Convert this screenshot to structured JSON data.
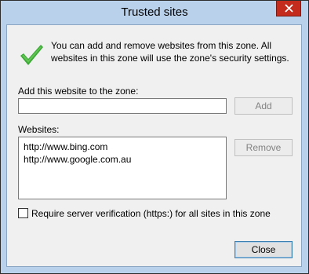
{
  "window": {
    "title": "Trusted sites"
  },
  "info_text": "You can add and remove websites from this zone. All websites in this zone will use the zone's security settings.",
  "add": {
    "label": "Add this website to the zone:",
    "value": "",
    "button": "Add"
  },
  "websites": {
    "label": "Websites:",
    "items": [
      "http://www.bing.com",
      "http://www.google.com.au"
    ],
    "remove_button": "Remove"
  },
  "require_verification": {
    "label": "Require server verification (https:) for all sites in this zone",
    "checked": false
  },
  "close_button": "Close",
  "icons": {
    "check": "green-checkmark-icon",
    "close": "close-icon"
  },
  "colors": {
    "titlebar": "#b9d1ea",
    "close": "#c42b1c",
    "check": "#3aaa35"
  }
}
